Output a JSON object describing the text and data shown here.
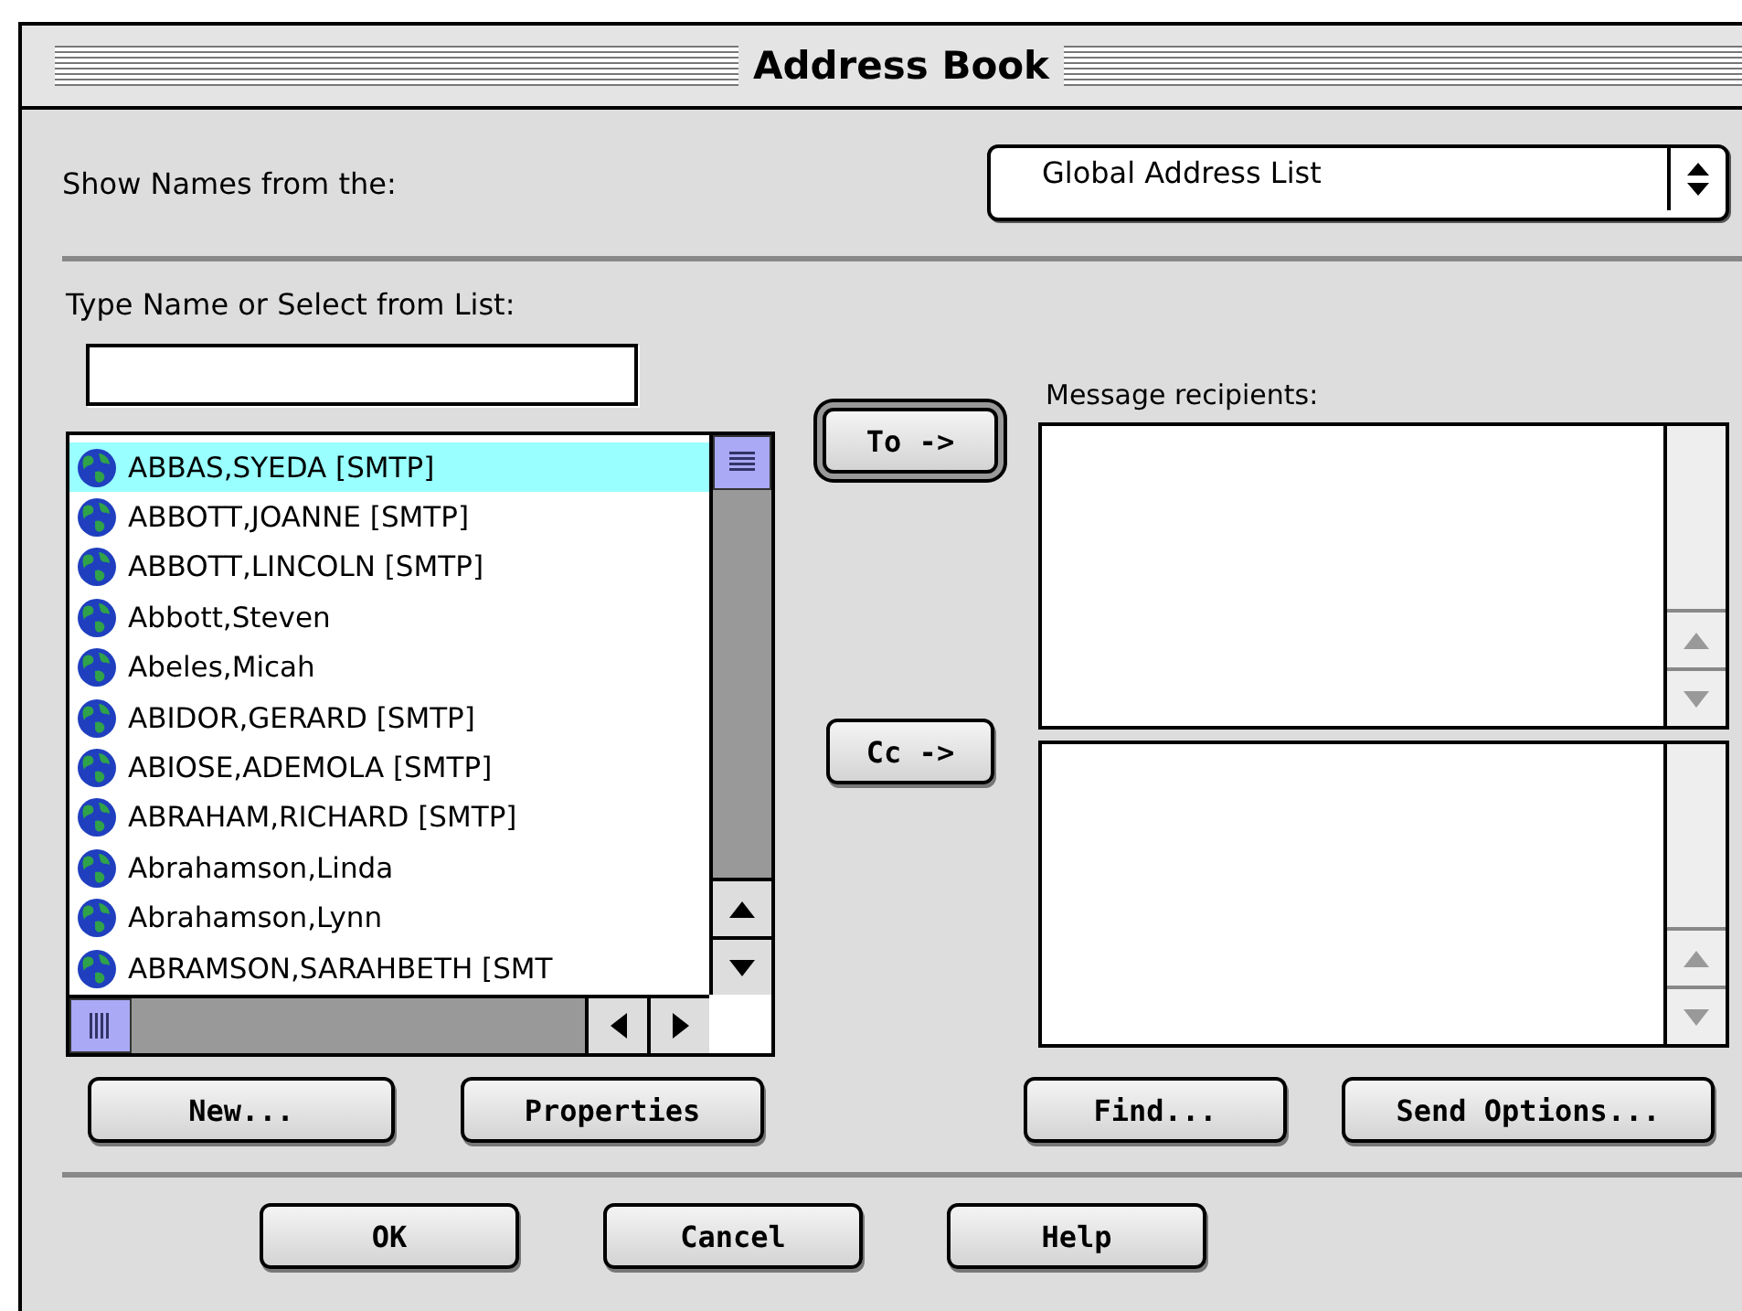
{
  "window": {
    "title": "Address Book"
  },
  "source": {
    "label": "Show Names from the:",
    "value": "Global Address List"
  },
  "search": {
    "label": "Type Name or Select from List:"
  },
  "recipients_label": "Message recipients:",
  "contacts": [
    {
      "name": "ABBAS,SYEDA [SMTP]",
      "selected": true
    },
    {
      "name": "ABBOTT,JOANNE [SMTP]",
      "selected": false
    },
    {
      "name": "ABBOTT,LINCOLN [SMTP]",
      "selected": false
    },
    {
      "name": "Abbott,Steven",
      "selected": false
    },
    {
      "name": "Abeles,Micah",
      "selected": false
    },
    {
      "name": "ABIDOR,GERARD [SMTP]",
      "selected": false
    },
    {
      "name": "ABIOSE,ADEMOLA [SMTP]",
      "selected": false
    },
    {
      "name": "ABRAHAM,RICHARD [SMTP]",
      "selected": false
    },
    {
      "name": "Abrahamson,Linda",
      "selected": false
    },
    {
      "name": "Abrahamson,Lynn",
      "selected": false
    },
    {
      "name": "ABRAMSON,SARAHBETH [SMT",
      "selected": false
    }
  ],
  "recipient_buttons": [
    {
      "label": "To ->",
      "default": true
    },
    {
      "label": "Cc ->",
      "default": false
    }
  ],
  "list_buttons": [
    "New...",
    "Properties"
  ],
  "recipient_actions": [
    "Find...",
    "Send Options..."
  ],
  "dialog_buttons": [
    "OK",
    "Cancel",
    "Help"
  ]
}
